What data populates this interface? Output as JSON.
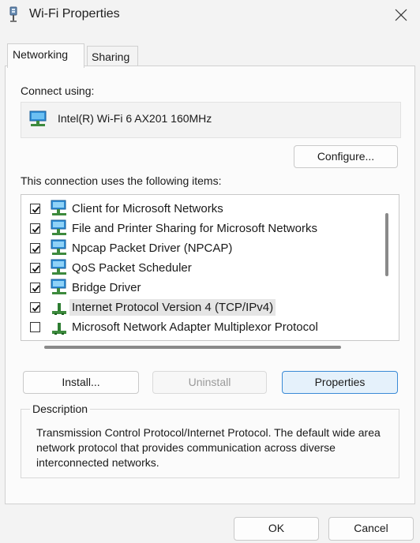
{
  "window": {
    "title": "Wi-Fi Properties",
    "close_glyph": "×"
  },
  "tabs": [
    {
      "label": "Networking",
      "active": true
    },
    {
      "label": "Sharing",
      "active": false
    }
  ],
  "connect_using": {
    "label": "Connect using:",
    "adapter": "Intel(R) Wi-Fi 6 AX201 160MHz",
    "adapter_icon": "network-adapter-icon"
  },
  "configure_button": "Configure...",
  "items_label": "This connection uses the following items:",
  "items": [
    {
      "label": "Client for Microsoft Networks",
      "checked": true,
      "icon": "network-client-icon"
    },
    {
      "label": "File and Printer Sharing for Microsoft Networks",
      "checked": true,
      "icon": "network-service-icon"
    },
    {
      "label": "Npcap Packet Driver (NPCAP)",
      "checked": true,
      "icon": "network-service-icon"
    },
    {
      "label": "QoS Packet Scheduler",
      "checked": true,
      "icon": "network-service-icon"
    },
    {
      "label": "Bridge Driver",
      "checked": true,
      "icon": "network-service-icon"
    },
    {
      "label": "Internet Protocol Version 4 (TCP/IPv4)",
      "checked": true,
      "icon": "protocol-icon",
      "selected": true
    },
    {
      "label": "Microsoft Network Adapter Multiplexor Protocol",
      "checked": false,
      "icon": "protocol-icon"
    }
  ],
  "buttons": {
    "install": "Install...",
    "uninstall": "Uninstall",
    "properties": "Properties",
    "ok": "OK",
    "cancel": "Cancel"
  },
  "description": {
    "legend": "Description",
    "text": "Transmission Control Protocol/Internet Protocol. The default wide area network protocol that provides communication across diverse interconnected networks."
  },
  "colors": {
    "accent": "#3a8ad6",
    "selection": "#e5e5e5"
  }
}
